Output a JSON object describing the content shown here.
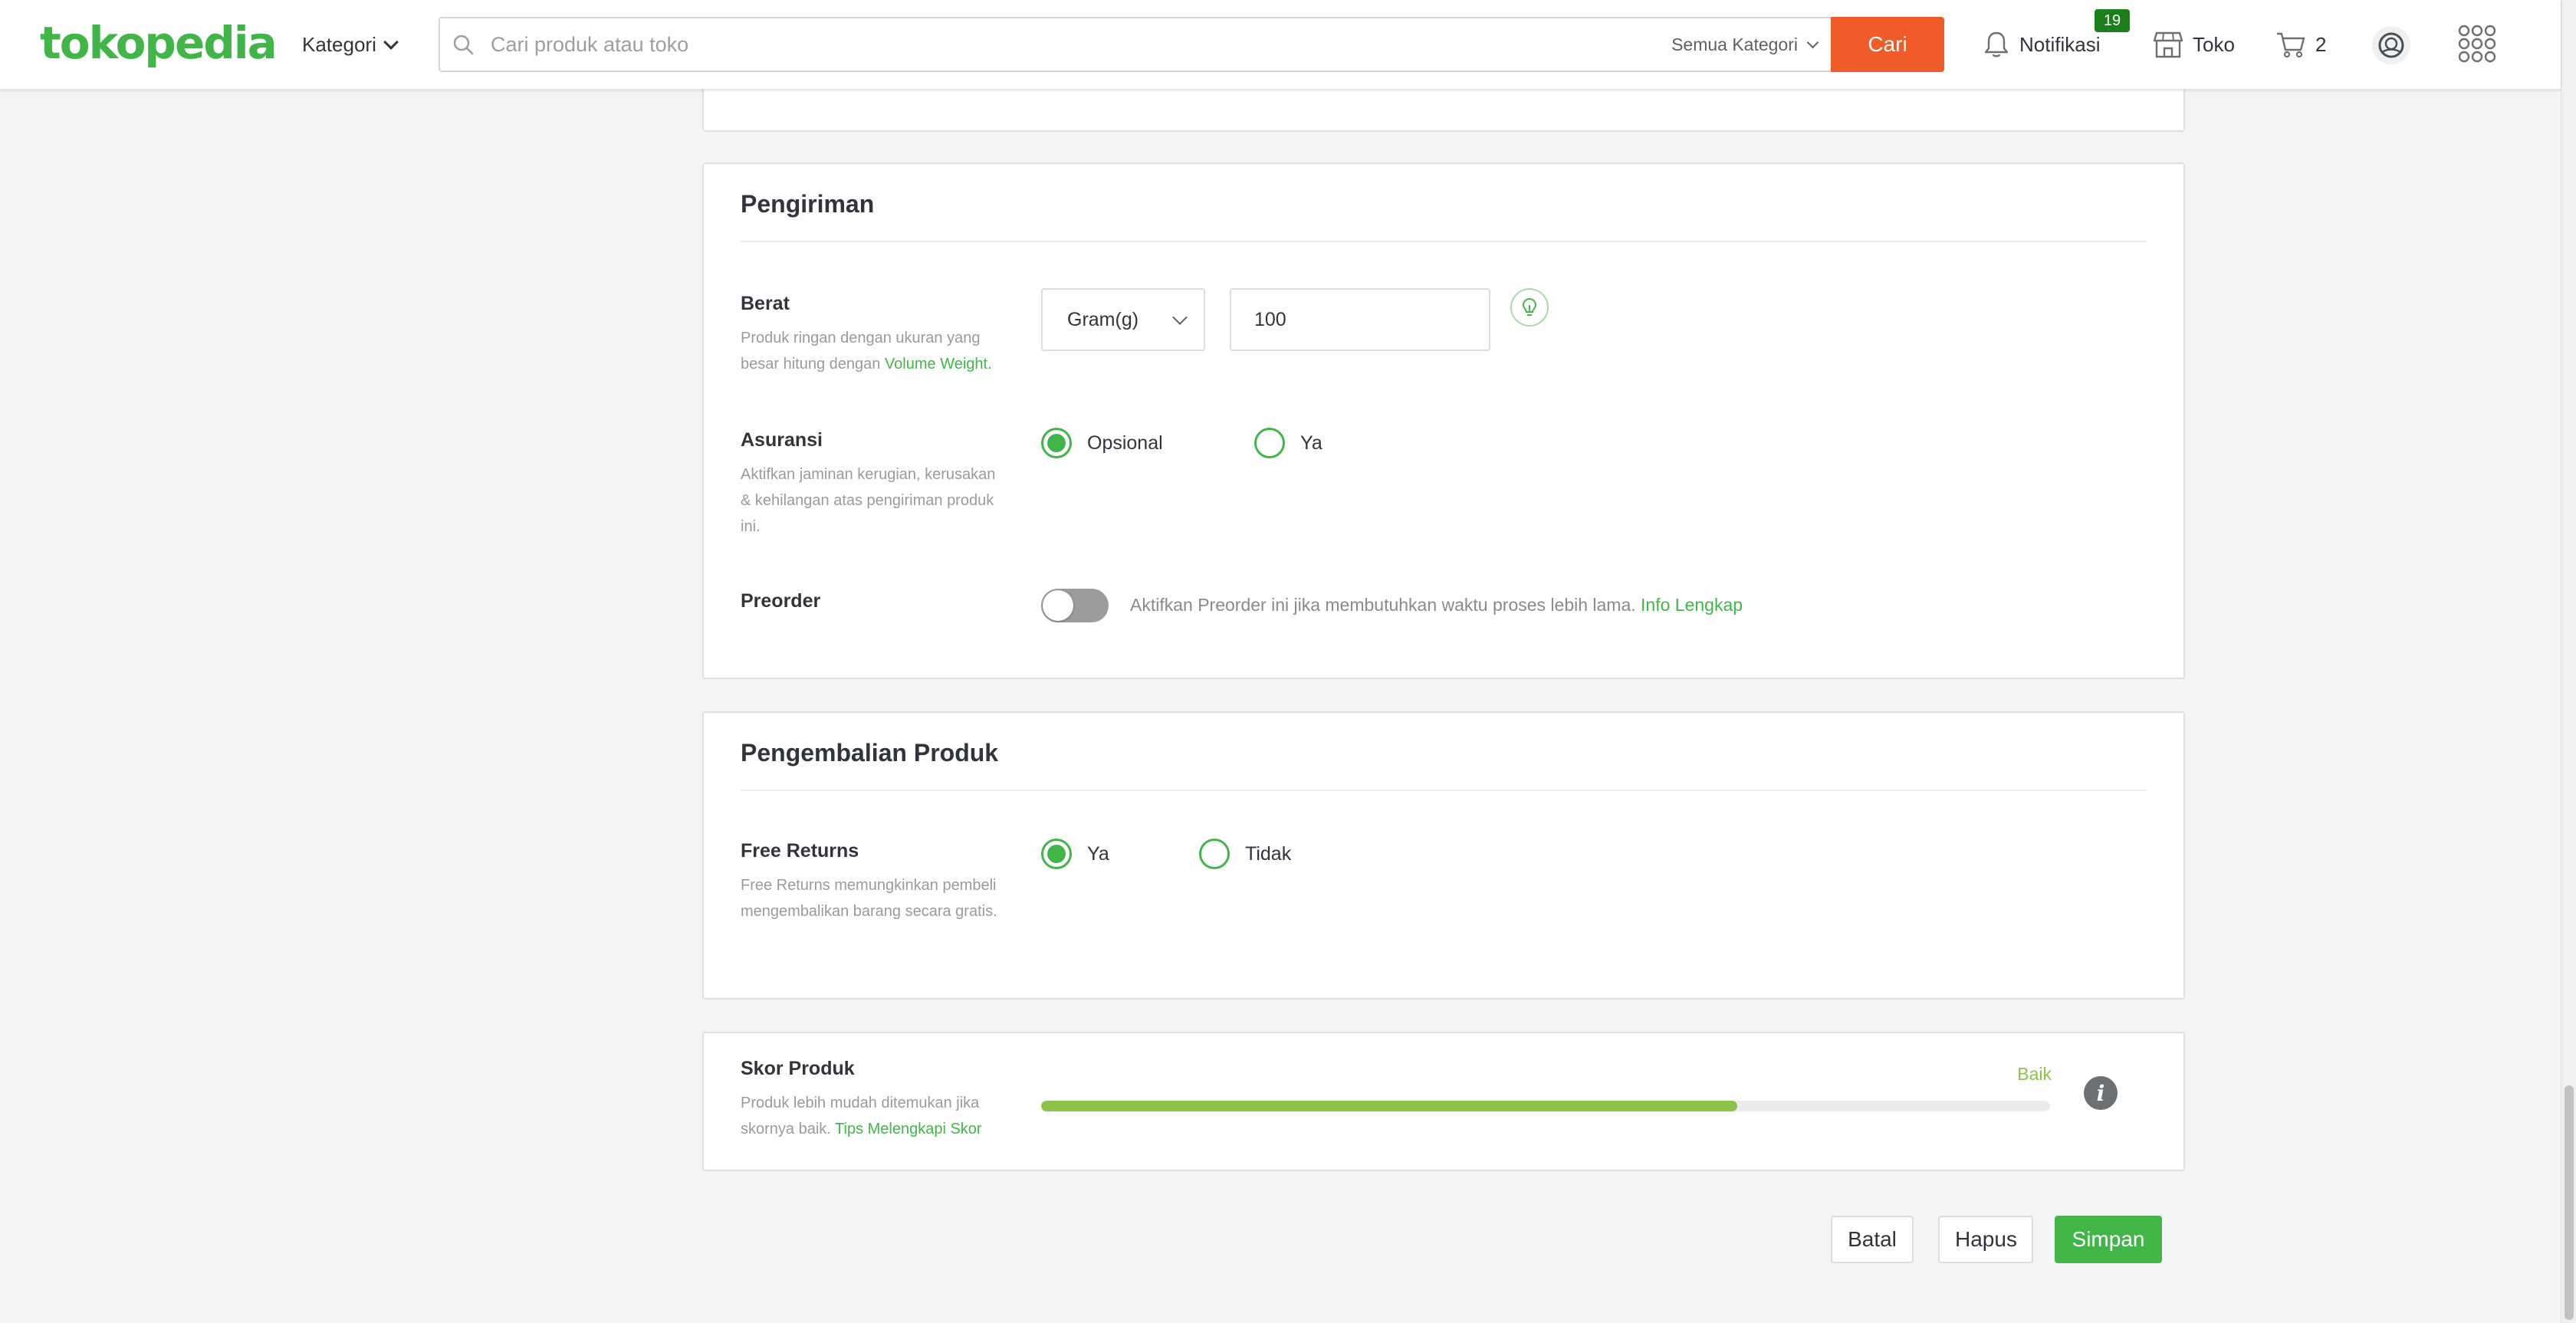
{
  "header": {
    "logo": "tokopedia",
    "kategori_label": "Kategori",
    "search_placeholder": "Cari produk atau toko",
    "search_category": "Semua Kategori",
    "search_button": "Cari",
    "notifications_label": "Notifikasi",
    "notifications_count": "19",
    "shop_label": "Toko",
    "cart_count": "2"
  },
  "pengiriman": {
    "title": "Pengiriman",
    "berat": {
      "label": "Berat",
      "help": "Produk ringan dengan ukuran yang besar hitung dengan ",
      "help_link": "Volume Weight.",
      "unit": "Gram(g)",
      "value": "100"
    },
    "asuransi": {
      "label": "Asuransi",
      "help": "Aktifkan jaminan kerugian, kerusakan & kehilangan atas pengiriman produk ini.",
      "options": [
        "Opsional",
        "Ya"
      ],
      "selected": "Opsional"
    },
    "preorder": {
      "label": "Preorder",
      "enabled": false,
      "help": "Aktifkan Preorder ini jika membutuhkan waktu proses lebih lama. ",
      "help_link": "Info Lengkap"
    }
  },
  "pengembalian": {
    "title": "Pengembalian Produk",
    "free_returns": {
      "label": "Free Returns",
      "help": "Free Returns memungkinkan pembeli mengembalikan barang secara gratis.",
      "options": [
        "Ya",
        "Tidak"
      ],
      "selected": "Ya"
    }
  },
  "skor": {
    "label": "Skor Produk",
    "help": "Produk lebih mudah ditemukan jika skornya baik. ",
    "help_link": "Tips Melengkapi Skor",
    "status": "Baik",
    "progress_percent": 69
  },
  "actions": {
    "cancel": "Batal",
    "delete": "Hapus",
    "save": "Simpan"
  },
  "colors": {
    "brand": "#42b549",
    "search_button": "#f05b2a",
    "score": "#8bc34a"
  }
}
